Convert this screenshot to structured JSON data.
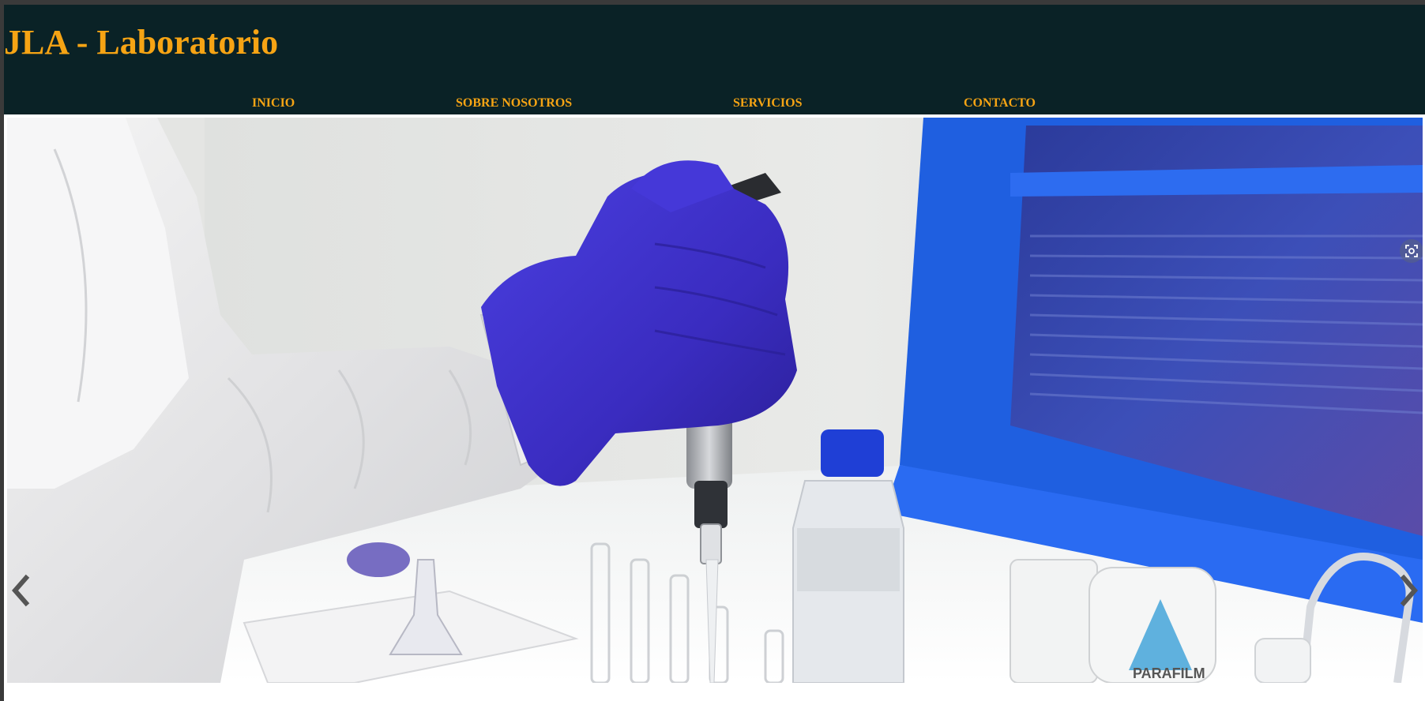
{
  "site": {
    "title": "JLA - Laboratorio"
  },
  "nav": {
    "items": [
      {
        "label": "INICIO"
      },
      {
        "label": "SOBRE NOSOTROS"
      },
      {
        "label": "SERVICIOS"
      },
      {
        "label": "CONTACTO"
      }
    ]
  },
  "carousel": {
    "prev_icon": "chevron-left-icon",
    "next_icon": "chevron-right-icon",
    "lens_icon": "visual-search-icon",
    "image_label": "PARAFILM"
  },
  "colors": {
    "header_bg": "#0a2226",
    "accent": "#f6a414",
    "glove": "#3e2fc4",
    "window_frame": "#1f5fe0"
  }
}
